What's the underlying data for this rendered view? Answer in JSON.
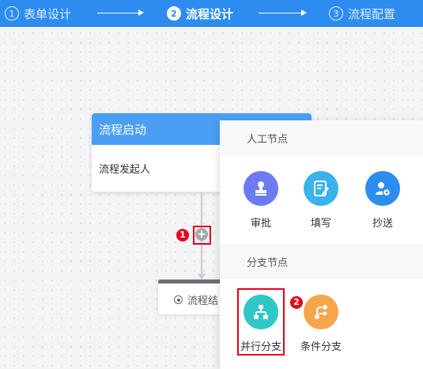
{
  "steps": [
    {
      "num": "1",
      "label": "表单设计"
    },
    {
      "num": "2",
      "label": "流程设计"
    },
    {
      "num": "3",
      "label": "流程配置"
    }
  ],
  "start_node": {
    "title": "流程启动",
    "body": "流程发起人"
  },
  "add_button": {
    "symbol": "+"
  },
  "end_node": {
    "label": "流程结"
  },
  "panel": {
    "manual_section": {
      "title": "人工节点",
      "options": [
        {
          "label": "审批",
          "icon": "approve-stamp-icon",
          "color": "#6c7cf0"
        },
        {
          "label": "填写",
          "icon": "fill-form-icon",
          "color": "#3ab2ea"
        },
        {
          "label": "抄送",
          "icon": "cc-user-icon",
          "color": "#2d8cf0"
        }
      ]
    },
    "branch_section": {
      "title": "分支节点",
      "options": [
        {
          "label": "并行分支",
          "icon": "parallel-branch-icon",
          "color": "#2ec6c6"
        },
        {
          "label": "条件分支",
          "icon": "condition-branch-icon",
          "color": "#f7a54b"
        }
      ]
    }
  },
  "annotations": {
    "badge1": "1",
    "badge2": "2"
  },
  "colors": {
    "header": "#2d8cf0",
    "highlight": "#e6001c"
  }
}
